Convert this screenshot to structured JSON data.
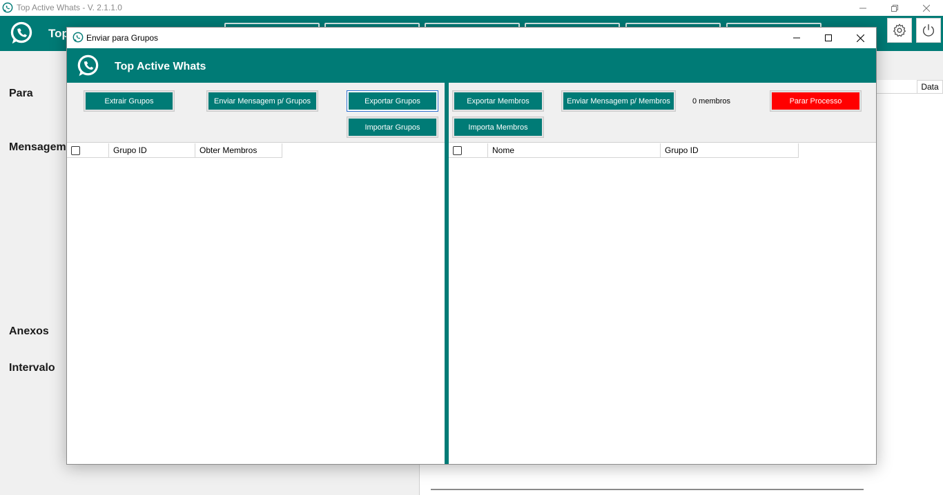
{
  "main_window": {
    "title": "Top Active Whats - V. 2.1.1.0",
    "brand_partial": "Top",
    "labels": {
      "para": "Para",
      "mensagem": "Mensagem",
      "anexos": "Anexos",
      "intervalo": "Intervalo"
    },
    "table_header_data": "Data"
  },
  "dialog": {
    "title": "Enviar para Grupos",
    "brand": "Top Active Whats",
    "buttons": {
      "extrair_grupos": "Extrair Grupos",
      "enviar_mensagem_grupos": "Enviar Mensagem p/ Grupos",
      "exportar_grupos": "Exportar Grupos",
      "importar_grupos": "Importar Grupos",
      "exportar_membros": "Exportar Membros",
      "enviar_mensagem_membros": "Enviar Mensagem p/ Membros",
      "importa_membros": "Importa Membros",
      "parar_processo": "Parar Processo"
    },
    "members_count": "0 membros",
    "groups_table": {
      "columns": [
        "Grupo ID",
        "Obter Membros"
      ],
      "rows": []
    },
    "members_table": {
      "columns": [
        "Nome",
        "Grupo ID"
      ],
      "rows": []
    }
  },
  "colors": {
    "teal": "#007b76",
    "danger": "#ff0000"
  }
}
